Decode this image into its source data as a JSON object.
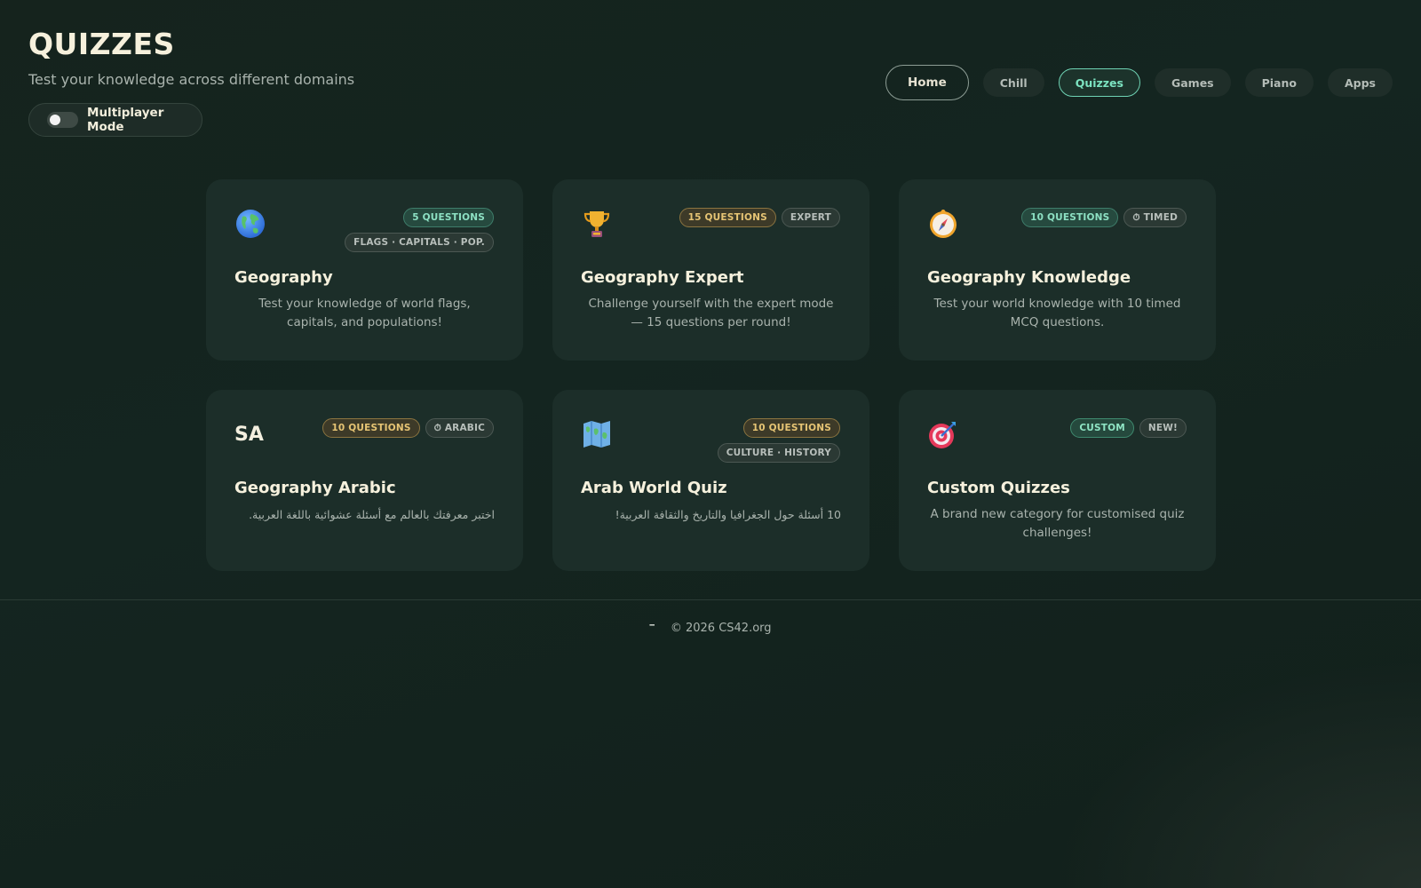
{
  "header": {
    "title": "QUIZZES",
    "subtitle": "Test your knowledge across different domains"
  },
  "multiplayer": {
    "label": "Multiplayer Mode",
    "enabled": false
  },
  "nav": {
    "items": [
      {
        "label": "Home"
      },
      {
        "label": "Chill"
      },
      {
        "label": "Quizzes",
        "active": true
      },
      {
        "label": "Games"
      },
      {
        "label": "Piano"
      },
      {
        "label": "Apps"
      }
    ]
  },
  "cards": [
    {
      "icon": "globe-icon",
      "title": "Geography",
      "badges": [
        "5 QUESTIONS",
        "FLAGS · CAPITALS · POP."
      ],
      "description": "Test your knowledge of world flags, capitals, and populations!"
    },
    {
      "icon": "trophy-icon",
      "title": "Geography Expert",
      "badges": [
        "15 QUESTIONS",
        "EXPERT"
      ],
      "description": "Challenge yourself with the expert mode — 15 questions per round!"
    },
    {
      "icon": "compass-icon",
      "title": "Geography Knowledge",
      "badges": [
        "10 QUESTIONS",
        "⏱ TIMED"
      ],
      "description": "Test your world knowledge with 10 timed MCQ questions."
    },
    {
      "icon_text": "SA",
      "title": "Geography Arabic",
      "badges": [
        "10 QUESTIONS",
        "⏱ ARABIC"
      ],
      "description": "اختبر معرفتك بالعالم مع أسئلة عشوائية باللغة العربية."
    },
    {
      "icon": "map-icon",
      "title": "Arab World Quiz",
      "badges": [
        "10 QUESTIONS",
        "CULTURE · HISTORY"
      ],
      "description": "10 أسئلة حول الجغرافيا والتاريخ والثقافة العربية!"
    },
    {
      "icon": "target-icon",
      "title": "Custom Quizzes",
      "badges": [
        "CUSTOM",
        "NEW!"
      ],
      "description": "A brand new category for customised quiz challenges!"
    }
  ],
  "footer": {
    "mark": "━",
    "copyright": "© 2026 CS42.org"
  },
  "colors": {
    "background": "#142520",
    "card": "#1c2e29",
    "accent": "#7ce3c1",
    "gold": "#e6c474"
  }
}
